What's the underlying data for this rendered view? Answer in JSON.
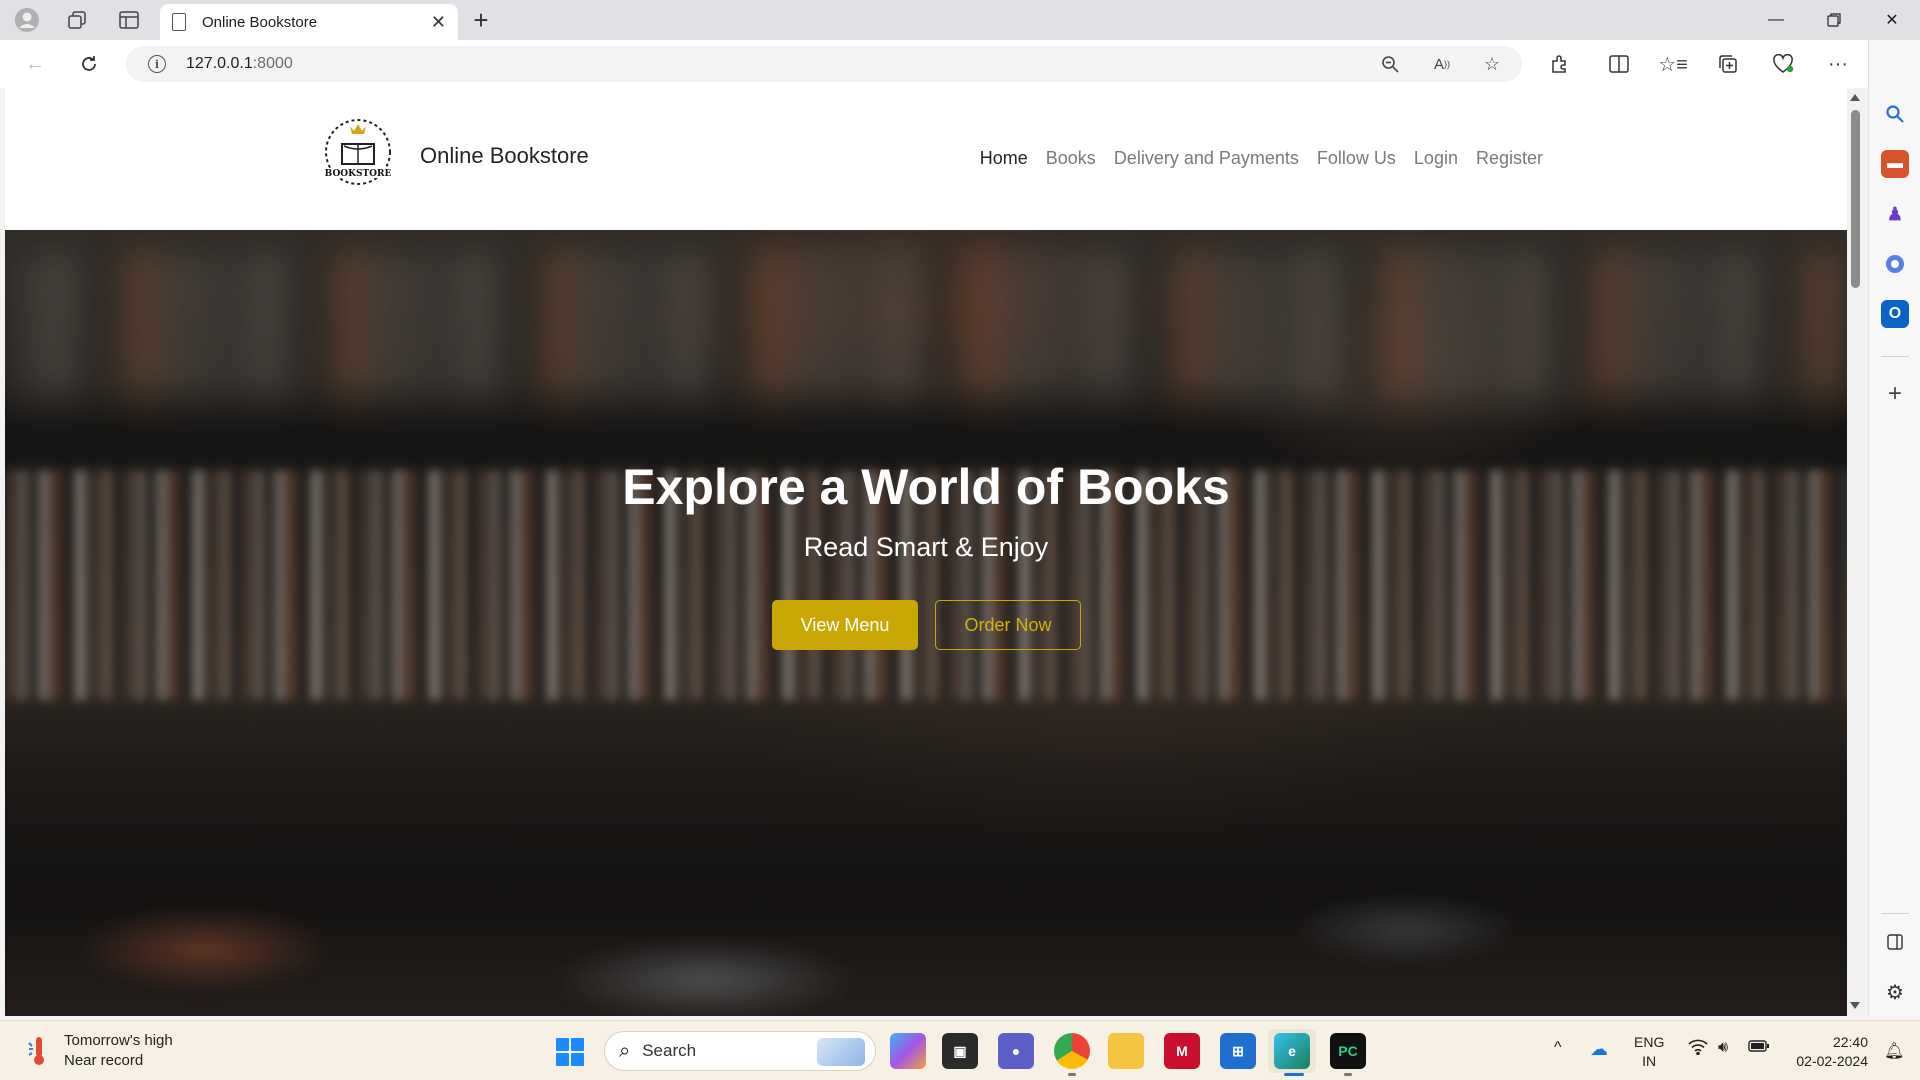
{
  "browser": {
    "tab_title": "Online Bookstore",
    "address": {
      "host": "127.0.0.1",
      "port": ":8000"
    }
  },
  "site": {
    "brand": "Online Bookstore",
    "nav": [
      {
        "label": "Home",
        "active": true
      },
      {
        "label": "Books"
      },
      {
        "label": "Delivery and Payments"
      },
      {
        "label": "Follow Us"
      },
      {
        "label": "Login"
      },
      {
        "label": "Register"
      }
    ],
    "hero": {
      "title": "Explore a World of Books",
      "subtitle": "Read Smart & Enjoy",
      "primary_button": "View Menu",
      "secondary_button": "Order Now"
    },
    "accent_color": "#c9a805"
  },
  "taskbar": {
    "weather_line1": "Tomorrow's high",
    "weather_line2": "Near record",
    "search_label": "Search",
    "lang_line1": "ENG",
    "lang_line2": "IN",
    "time": "22:40",
    "date": "02-02-2024"
  }
}
